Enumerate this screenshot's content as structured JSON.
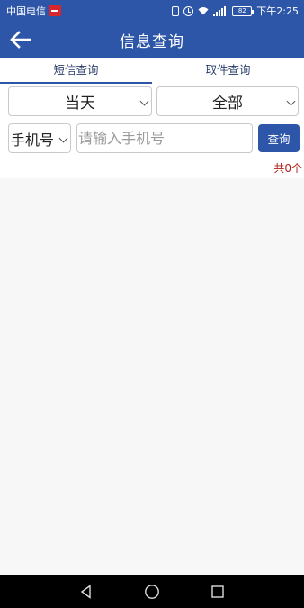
{
  "status_bar": {
    "carrier": "中国电信",
    "battery": "82",
    "time": "下午2:25"
  },
  "header": {
    "title": "信息查询"
  },
  "tabs": [
    {
      "label": "短信查询",
      "active": true
    },
    {
      "label": "取件查询",
      "active": false
    }
  ],
  "filters": {
    "date_range": "当天",
    "category": "全部",
    "search_field": "手机号",
    "phone_value": "",
    "phone_placeholder": "请输入手机号",
    "query_label": "查询",
    "result_count": "共0个"
  },
  "colors": {
    "primary": "#2d56a8",
    "count_text": "#b0231c",
    "background": "#f7f7f7"
  },
  "icons": {
    "back": "arrow-left-icon",
    "nav_back": "triangle-back-icon",
    "nav_home": "circle-home-icon",
    "nav_recent": "square-recent-icon"
  }
}
